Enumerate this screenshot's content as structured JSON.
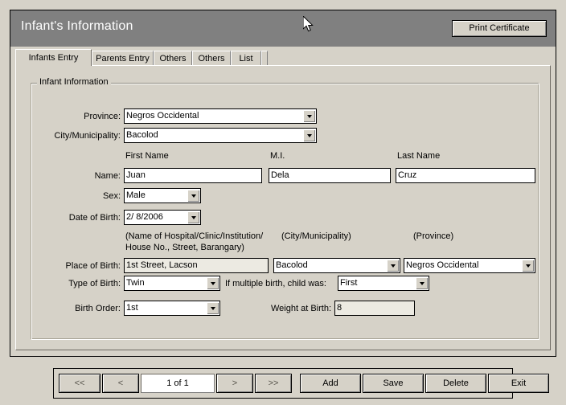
{
  "window": {
    "title": "Infant's Information",
    "print_button": "Print Certificate"
  },
  "tabs": [
    {
      "label": "Infants Entry",
      "active": true
    },
    {
      "label": "Parents Entry",
      "active": false
    },
    {
      "label": "Others",
      "active": false
    },
    {
      "label": "Others",
      "active": false
    },
    {
      "label": "List",
      "active": false
    }
  ],
  "group": {
    "title": "Infant Information"
  },
  "form": {
    "province_label": "Province:",
    "province_value": "Negros Occidental",
    "city_label": "City/Municipality:",
    "city_value": "Bacolod",
    "first_name_header": "First Name",
    "mi_header": "M.I.",
    "last_name_header": "Last Name",
    "name_label": "Name:",
    "first_name_value": "Juan",
    "mi_value": "Dela",
    "last_name_value": "Cruz",
    "sex_label": "Sex:",
    "sex_value": "Male",
    "dob_label": "Date of Birth:",
    "dob_value": "2/  8/2006",
    "pob_hint_line1": "(Name of Hospital/Clinic/Institution/",
    "pob_hint_line2": "House No., Street, Barangary)",
    "pob_hint_city": "(City/Municipality)",
    "pob_hint_province": "(Province)",
    "pob_label": "Place of Birth:",
    "pob_value": "1st Street, Lacson",
    "pob_city_value": "Bacolod",
    "pob_province_value": "Negros Occidental",
    "type_label": "Type of Birth:",
    "type_value": "Twin",
    "multiple_label": "If multiple birth, child was:",
    "multiple_value": "First",
    "order_label": "Birth Order:",
    "order_value": "1st",
    "weight_label": "Weight at Birth:",
    "weight_value": "8"
  },
  "navbar": {
    "first": "<<",
    "prev": "<",
    "page": "1 of 1",
    "next": ">",
    "last": ">>",
    "add": "Add",
    "save": "Save",
    "delete": "Delete",
    "exit": "Exit"
  },
  "colors": {
    "window_face": "#d6d2c8",
    "titlebar": "#808080",
    "title_text": "#ffffff",
    "field_bg": "#ffffff",
    "readonly_field_bg": "#eceae2",
    "border": "#000000"
  }
}
